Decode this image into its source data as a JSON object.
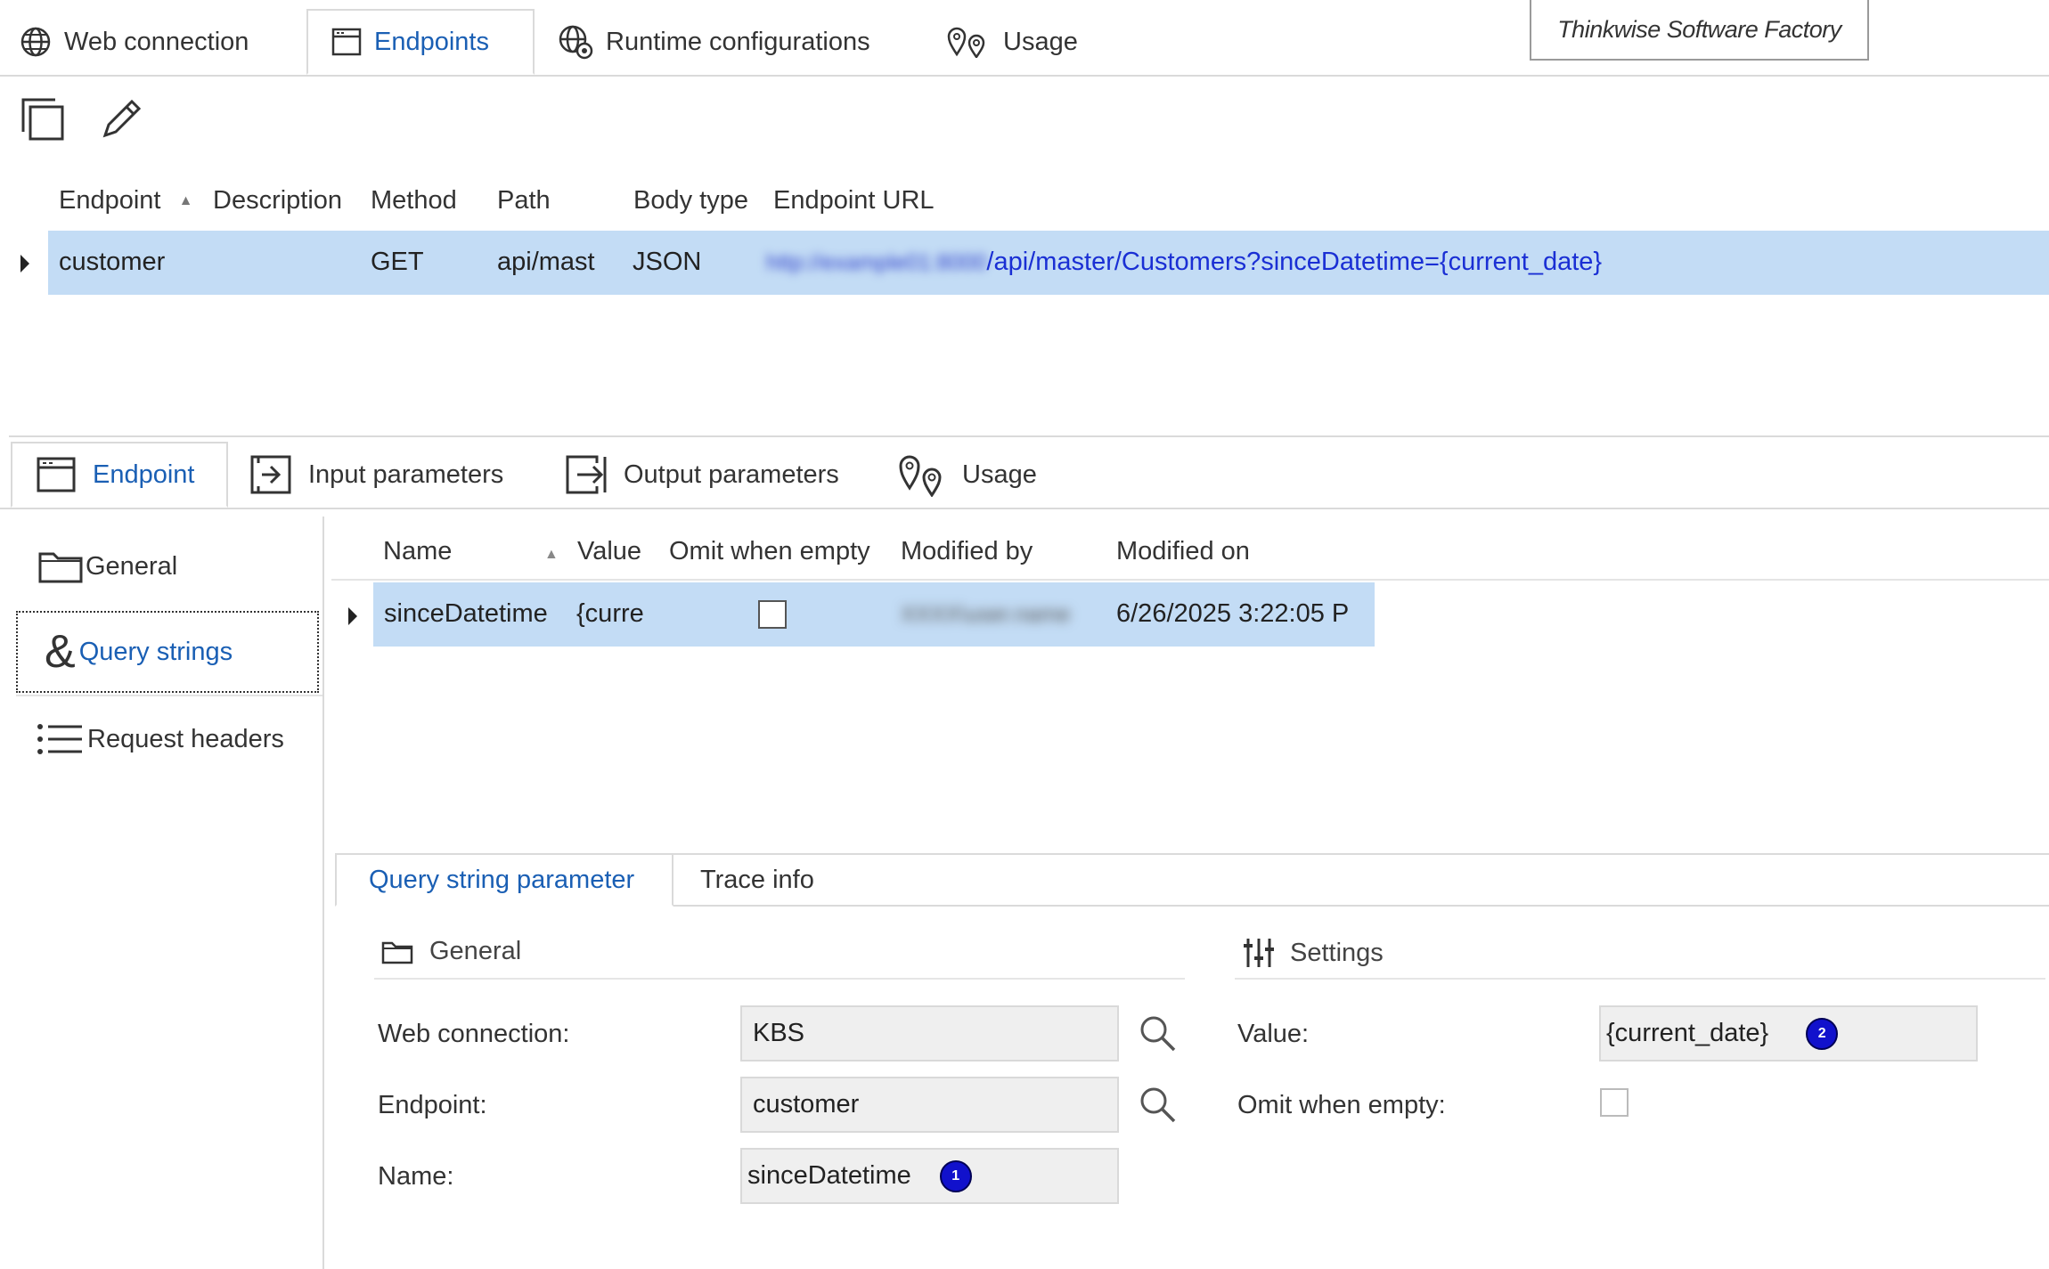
{
  "top_tabs": [
    {
      "label": "Web connection",
      "icon": "globe-icon"
    },
    {
      "label": "Endpoints",
      "icon": "window-icon",
      "active": true
    },
    {
      "label": "Runtime configurations",
      "icon": "globe-gear-icon"
    },
    {
      "label": "Usage",
      "icon": "location-pins-icon"
    }
  ],
  "brand": "Thinkwise Software Factory",
  "toolbar": {
    "copy_icon": "copy-icon",
    "edit_icon": "pencil-icon"
  },
  "endpoints_grid": {
    "columns": [
      "Endpoint",
      "Description",
      "Method",
      "Path",
      "Body type",
      "Endpoint URL"
    ],
    "sort_column": "Endpoint",
    "rows": [
      {
        "endpoint": "customer",
        "description": "",
        "method": "GET",
        "path": "api/mast",
        "body_type": "JSON",
        "url_host_blurred": "http://example01:8000",
        "url_path": "/api/master/Customers?sinceDatetime={current_date}"
      }
    ]
  },
  "sub_tabs": [
    {
      "label": "Endpoint",
      "icon": "window-icon",
      "active": true
    },
    {
      "label": "Input parameters",
      "icon": "input-arrow-icon"
    },
    {
      "label": "Output parameters",
      "icon": "output-arrow-icon"
    },
    {
      "label": "Usage",
      "icon": "location-pins-icon"
    }
  ],
  "left_nav": [
    {
      "label": "General",
      "icon": "folder-icon"
    },
    {
      "label": "Query strings",
      "icon": "ampersand-icon",
      "active": true
    },
    {
      "label": "Request headers",
      "icon": "list-icon"
    }
  ],
  "query_grid": {
    "columns": [
      "Name",
      "Value",
      "Omit when empty",
      "Modified by",
      "Modified on"
    ],
    "sort_column": "Name",
    "rows": [
      {
        "name": "sinceDatetime",
        "value": "{curre",
        "omit_when_empty": false,
        "modified_by_blurred": "XXXX\\user.name",
        "modified_on": "6/26/2025 3:22:05 P"
      }
    ]
  },
  "detail_tabs": [
    {
      "label": "Query string parameter",
      "active": true
    },
    {
      "label": "Trace info"
    }
  ],
  "form": {
    "general_section": "General",
    "settings_section": "Settings",
    "web_connection_label": "Web connection:",
    "web_connection_value": "KBS",
    "endpoint_label": "Endpoint:",
    "endpoint_value": "customer",
    "name_label": "Name:",
    "name_value": "sinceDatetime",
    "name_badge": "1",
    "value_label": "Value:",
    "value_value": "{current_date}",
    "value_badge": "2",
    "omit_label": "Omit when empty:",
    "omit_value": false
  },
  "colors": {
    "accent": "#1a5fb4",
    "selection": "#c3dcf5",
    "badge": "#1111cc"
  }
}
